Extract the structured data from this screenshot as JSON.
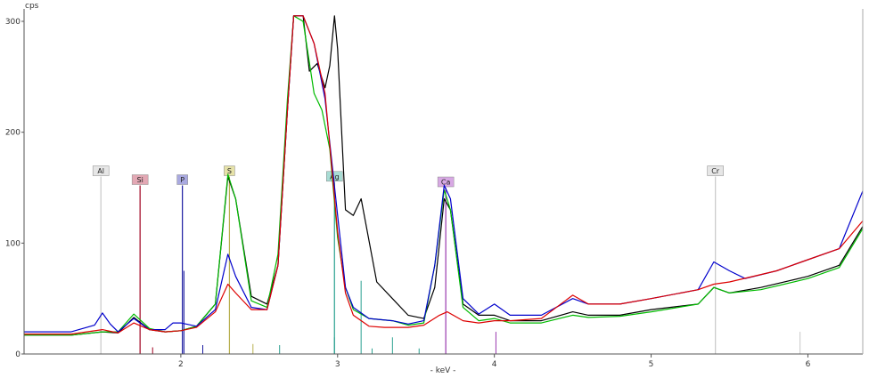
{
  "chart_data": {
    "type": "line",
    "ylabel": "cps",
    "xlabel": "- keV -",
    "xlim": [
      1.0,
      6.35
    ],
    "ylim": [
      0,
      300
    ],
    "x_ticks": [
      2,
      3,
      4,
      5,
      6
    ],
    "y_ticks": [
      0,
      100,
      200,
      300
    ],
    "grid": false,
    "series": [
      {
        "color": "#000000",
        "points": [
          [
            1.0,
            17
          ],
          [
            1.3,
            17
          ],
          [
            1.5,
            20
          ],
          [
            1.6,
            19
          ],
          [
            1.7,
            33
          ],
          [
            1.8,
            22
          ],
          [
            1.9,
            20
          ],
          [
            2.0,
            21
          ],
          [
            2.1,
            25
          ],
          [
            2.22,
            45
          ],
          [
            2.3,
            160
          ],
          [
            2.35,
            140
          ],
          [
            2.45,
            52
          ],
          [
            2.55,
            45
          ],
          [
            2.62,
            80
          ],
          [
            2.68,
            220
          ],
          [
            2.72,
            305
          ],
          [
            2.78,
            305
          ],
          [
            2.82,
            255
          ],
          [
            2.87,
            262
          ],
          [
            2.92,
            240
          ],
          [
            2.95,
            260
          ],
          [
            2.98,
            305
          ],
          [
            3.0,
            275
          ],
          [
            3.05,
            130
          ],
          [
            3.1,
            125
          ],
          [
            3.15,
            140
          ],
          [
            3.25,
            65
          ],
          [
            3.35,
            50
          ],
          [
            3.45,
            35
          ],
          [
            3.55,
            32
          ],
          [
            3.62,
            60
          ],
          [
            3.68,
            140
          ],
          [
            3.72,
            130
          ],
          [
            3.8,
            45
          ],
          [
            3.9,
            35
          ],
          [
            4.0,
            35
          ],
          [
            4.1,
            30
          ],
          [
            4.3,
            30
          ],
          [
            4.5,
            38
          ],
          [
            4.6,
            35
          ],
          [
            4.8,
            35
          ],
          [
            5.0,
            40
          ],
          [
            5.3,
            45
          ],
          [
            5.4,
            60
          ],
          [
            5.5,
            55
          ],
          [
            5.7,
            60
          ],
          [
            6.0,
            70
          ],
          [
            6.2,
            80
          ],
          [
            6.35,
            115
          ]
        ]
      },
      {
        "color": "#00bb00",
        "points": [
          [
            1.0,
            17
          ],
          [
            1.3,
            17
          ],
          [
            1.5,
            20
          ],
          [
            1.6,
            20
          ],
          [
            1.7,
            36
          ],
          [
            1.8,
            23
          ],
          [
            1.9,
            20
          ],
          [
            2.0,
            21
          ],
          [
            2.1,
            25
          ],
          [
            2.22,
            45
          ],
          [
            2.3,
            162
          ],
          [
            2.35,
            140
          ],
          [
            2.45,
            48
          ],
          [
            2.55,
            42
          ],
          [
            2.62,
            90
          ],
          [
            2.68,
            230
          ],
          [
            2.72,
            305
          ],
          [
            2.78,
            300
          ],
          [
            2.85,
            235
          ],
          [
            2.9,
            220
          ],
          [
            2.95,
            185
          ],
          [
            3.0,
            105
          ],
          [
            3.05,
            60
          ],
          [
            3.1,
            40
          ],
          [
            3.2,
            32
          ],
          [
            3.35,
            30
          ],
          [
            3.45,
            26
          ],
          [
            3.55,
            28
          ],
          [
            3.62,
            80
          ],
          [
            3.68,
            148
          ],
          [
            3.72,
            130
          ],
          [
            3.8,
            42
          ],
          [
            3.9,
            30
          ],
          [
            4.0,
            32
          ],
          [
            4.1,
            28
          ],
          [
            4.3,
            28
          ],
          [
            4.5,
            35
          ],
          [
            4.6,
            33
          ],
          [
            4.8,
            34
          ],
          [
            5.0,
            38
          ],
          [
            5.3,
            45
          ],
          [
            5.4,
            60
          ],
          [
            5.5,
            55
          ],
          [
            5.7,
            58
          ],
          [
            6.0,
            68
          ],
          [
            6.2,
            78
          ],
          [
            6.35,
            113
          ]
        ]
      },
      {
        "color": "#0000cc",
        "points": [
          [
            1.0,
            20
          ],
          [
            1.3,
            20
          ],
          [
            1.45,
            26
          ],
          [
            1.5,
            37
          ],
          [
            1.55,
            27
          ],
          [
            1.6,
            20
          ],
          [
            1.7,
            32
          ],
          [
            1.8,
            22
          ],
          [
            1.9,
            22
          ],
          [
            1.95,
            28
          ],
          [
            2.0,
            28
          ],
          [
            2.1,
            25
          ],
          [
            2.22,
            40
          ],
          [
            2.3,
            90
          ],
          [
            2.35,
            70
          ],
          [
            2.45,
            42
          ],
          [
            2.55,
            40
          ],
          [
            2.62,
            80
          ],
          [
            2.68,
            220
          ],
          [
            2.72,
            305
          ],
          [
            2.78,
            305
          ],
          [
            2.85,
            280
          ],
          [
            2.92,
            230
          ],
          [
            3.0,
            125
          ],
          [
            3.05,
            60
          ],
          [
            3.1,
            42
          ],
          [
            3.2,
            32
          ],
          [
            3.35,
            30
          ],
          [
            3.45,
            27
          ],
          [
            3.55,
            30
          ],
          [
            3.62,
            80
          ],
          [
            3.68,
            152
          ],
          [
            3.72,
            140
          ],
          [
            3.8,
            50
          ],
          [
            3.9,
            36
          ],
          [
            4.0,
            45
          ],
          [
            4.1,
            35
          ],
          [
            4.3,
            35
          ],
          [
            4.5,
            50
          ],
          [
            4.6,
            45
          ],
          [
            4.8,
            45
          ],
          [
            5.0,
            50
          ],
          [
            5.3,
            58
          ],
          [
            5.4,
            83
          ],
          [
            5.5,
            75
          ],
          [
            5.6,
            68
          ],
          [
            5.8,
            75
          ],
          [
            6.0,
            85
          ],
          [
            6.2,
            95
          ],
          [
            6.35,
            147
          ]
        ]
      },
      {
        "color": "#dd0000",
        "points": [
          [
            1.0,
            18
          ],
          [
            1.3,
            18
          ],
          [
            1.5,
            22
          ],
          [
            1.6,
            19
          ],
          [
            1.7,
            28
          ],
          [
            1.8,
            22
          ],
          [
            1.9,
            20
          ],
          [
            2.0,
            21
          ],
          [
            2.1,
            24
          ],
          [
            2.22,
            38
          ],
          [
            2.3,
            63
          ],
          [
            2.35,
            55
          ],
          [
            2.45,
            40
          ],
          [
            2.55,
            40
          ],
          [
            2.62,
            80
          ],
          [
            2.68,
            220
          ],
          [
            2.72,
            305
          ],
          [
            2.78,
            305
          ],
          [
            2.85,
            280
          ],
          [
            2.92,
            235
          ],
          [
            3.0,
            110
          ],
          [
            3.05,
            55
          ],
          [
            3.1,
            35
          ],
          [
            3.2,
            25
          ],
          [
            3.3,
            24
          ],
          [
            3.45,
            24
          ],
          [
            3.55,
            26
          ],
          [
            3.65,
            35
          ],
          [
            3.7,
            38
          ],
          [
            3.8,
            30
          ],
          [
            3.9,
            28
          ],
          [
            4.0,
            30
          ],
          [
            4.1,
            30
          ],
          [
            4.3,
            32
          ],
          [
            4.5,
            53
          ],
          [
            4.6,
            45
          ],
          [
            4.8,
            45
          ],
          [
            5.0,
            50
          ],
          [
            5.3,
            58
          ],
          [
            5.4,
            63
          ],
          [
            5.5,
            65
          ],
          [
            5.8,
            75
          ],
          [
            6.0,
            85
          ],
          [
            6.2,
            95
          ],
          [
            6.35,
            120
          ]
        ]
      }
    ],
    "markers": [
      {
        "label": "Al",
        "energy": 1.49,
        "height": 160,
        "color": "#c8c8c8",
        "label_bg": "#e6e6e6"
      },
      {
        "label": "Si",
        "energy": 1.74,
        "height": 152,
        "color": "#a00020",
        "label_bg": "#e3a8b4"
      },
      {
        "label": "P",
        "energy": 2.01,
        "height": 152,
        "color": "#1a1aa0",
        "label_bg": "#a9a9e0"
      },
      {
        "label": "S",
        "energy": 2.31,
        "height": 160,
        "color": "#b8b050",
        "label_bg": "#e6e2a8"
      },
      {
        "label": "Ag",
        "energy": 2.98,
        "height": 155,
        "color": "#2aa090",
        "label_bg": "#a8dcd4"
      },
      {
        "label": "Ca",
        "energy": 3.69,
        "height": 150,
        "color": "#9a3ab0",
        "label_bg": "#d8a8e4"
      },
      {
        "label": "Cr",
        "energy": 5.41,
        "height": 160,
        "color": "#c8c8c8",
        "label_bg": "#e6e6e6"
      }
    ],
    "lines": [
      {
        "energy": 1.82,
        "height": 6,
        "color": "#a00020"
      },
      {
        "energy": 2.02,
        "height": 75,
        "color": "#1a1aa0"
      },
      {
        "energy": 2.14,
        "height": 8,
        "color": "#1a1aa0"
      },
      {
        "energy": 2.46,
        "height": 9,
        "color": "#b8b050"
      },
      {
        "energy": 2.63,
        "height": 8,
        "color": "#2aa090"
      },
      {
        "energy": 2.98,
        "height": 15,
        "color": "#2aa090"
      },
      {
        "energy": 3.15,
        "height": 66,
        "color": "#2aa090"
      },
      {
        "energy": 3.22,
        "height": 5,
        "color": "#2aa090"
      },
      {
        "energy": 3.35,
        "height": 15,
        "color": "#2aa090"
      },
      {
        "energy": 3.52,
        "height": 5,
        "color": "#2aa090"
      },
      {
        "energy": 4.01,
        "height": 20,
        "color": "#9a3ab0"
      },
      {
        "energy": 5.95,
        "height": 20,
        "color": "#c8c8c8"
      }
    ]
  }
}
